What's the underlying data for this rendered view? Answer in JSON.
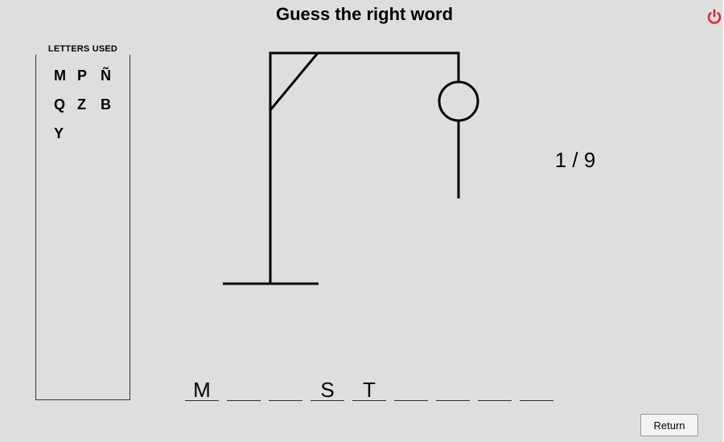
{
  "header": {
    "title": "Guess the right word"
  },
  "letters_panel": {
    "title": "LETTERS USED",
    "letters": [
      "M",
      "P",
      "Ñ",
      "Q",
      "Z",
      "B",
      "Y"
    ]
  },
  "attempts": {
    "text": "1 / 9",
    "current": 1,
    "max": 9
  },
  "word": {
    "slots": [
      "M",
      "",
      "",
      "S",
      "T",
      "",
      "",
      "",
      ""
    ]
  },
  "buttons": {
    "return_label": "Return"
  },
  "icons": {
    "power": "power-icon"
  },
  "colors": {
    "power_icon": "#e8232b",
    "background": "#dedede",
    "line": "#000000"
  }
}
